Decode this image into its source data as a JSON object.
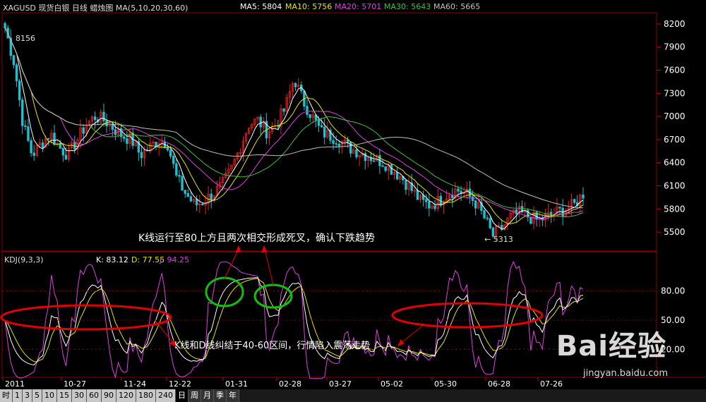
{
  "header": {
    "symbol": "XAGUSD 现货白银 日线 蜡烛图 MA(5,10,20,30,60)",
    "ma5": "MA5: 5804",
    "ma10": "MA10: 5756",
    "ma20": "MA20: 5701",
    "ma30": "MA30: 5643",
    "ma60": "MA60: 5665"
  },
  "kdj_header": {
    "title": "KDJ(9,3,3)",
    "k": "K: 83.12",
    "d": "D: 77.55",
    "j": "J: 94.25"
  },
  "annotations": {
    "top_note": "K线运行至80上方且两次相交形成死叉，确认下跌趋势",
    "bottom_note": "K线和D线纠结于40-60区间，行情陷入震荡走势",
    "high_label": "8156",
    "low_label": "← 5313"
  },
  "watermark": {
    "brand": "Bai经验",
    "url": "jingyan.baidu.com"
  },
  "tabs": [
    "时",
    "1",
    "3",
    "5",
    "10",
    "15",
    "30",
    "60",
    "90",
    "120",
    "180",
    "240",
    "日",
    "周",
    "月",
    "季",
    "年"
  ],
  "active_tab": "日",
  "colors": {
    "up": "#e02020",
    "down": "#20c0d0",
    "ma5": "#ffffff",
    "ma10": "#e6e600",
    "ma20": "#e040e0",
    "ma30": "#40c040",
    "ma60": "#c0c0c0",
    "ellipse_red": "#e00000",
    "ellipse_green": "#10c010"
  },
  "chart_data": [
    {
      "type": "candlestick",
      "title": "XAGUSD 现货白银 日线",
      "ylim": [
        5300,
        8300
      ],
      "y_ticks": [
        8200,
        7900,
        7600,
        7300,
        7000,
        6700,
        6400,
        6100,
        5800,
        5500
      ],
      "x_tick_labels": [
        "2011",
        "10-27",
        "11-24",
        "12-22",
        "01-31",
        "02-28",
        "03-27",
        "05-02",
        "05-30",
        "06-28",
        "07-26"
      ],
      "close_path": [
        8150,
        7700,
        6900,
        6500,
        6650,
        6780,
        6600,
        6500,
        6700,
        6900,
        7000,
        6950,
        6850,
        6750,
        6700,
        6500,
        6600,
        6700,
        6650,
        6200,
        6000,
        5850,
        5900,
        6000,
        6100,
        6300,
        6600,
        6900,
        6950,
        6800,
        6900,
        7100,
        7500,
        7200,
        7000,
        6800,
        6750,
        6700,
        6600,
        6550,
        6500,
        6450,
        6400,
        6300,
        6200,
        6050,
        5900,
        5850,
        5900,
        6000,
        6050,
        6000,
        5900,
        5700,
        5450,
        5550,
        5700,
        5750,
        5700,
        5650,
        5700,
        5750,
        5800,
        5850,
        6000
      ],
      "high": 8156,
      "low": 5313,
      "last_ma": {
        "MA5": 5804,
        "MA10": 5756,
        "MA20": 5701,
        "MA30": 5643,
        "MA60": 5665
      }
    },
    {
      "type": "line",
      "title": "KDJ(9,3,3)",
      "ylim": [
        0,
        100
      ],
      "y_ticks": [
        80.0,
        50.0,
        20.0
      ],
      "last": {
        "K": 83.12,
        "D": 77.55,
        "J": 94.25
      }
    }
  ]
}
